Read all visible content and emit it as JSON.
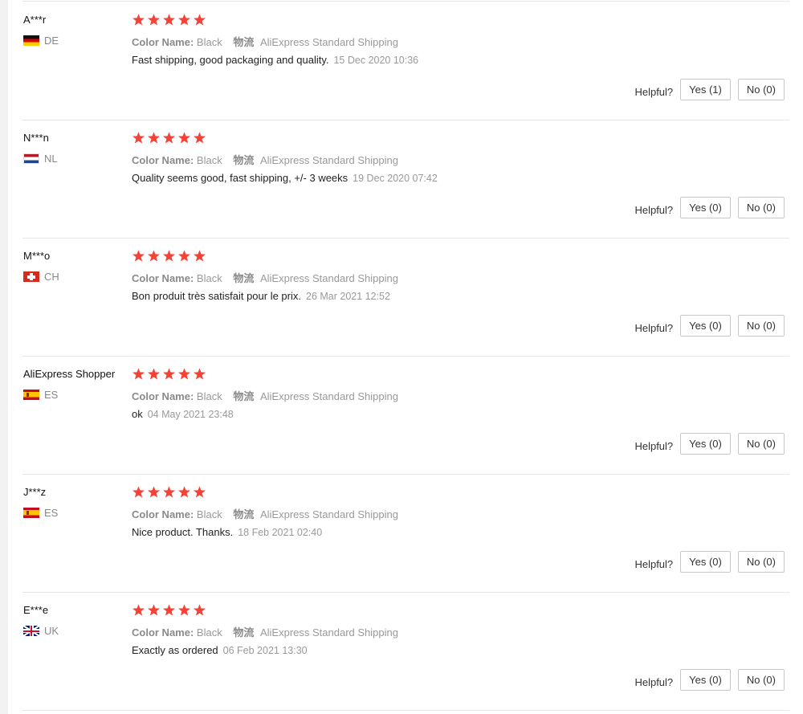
{
  "colors": {
    "star": "#f44336",
    "divider": "#e6e6e6",
    "muted": "#999999"
  },
  "labels": {
    "color_name": "Color Name:",
    "logistics": "物流",
    "helpful": "Helpful?"
  },
  "reviews": [
    {
      "user": "A***r",
      "country": "DE",
      "flag_icon": "flag-de-icon",
      "rating": 5,
      "color": "Black",
      "shipping": "AliExpress Standard Shipping",
      "text": "Fast shipping, good packaging and quality.",
      "date": "15 Dec 2020 10:36",
      "yes": "Yes (1)",
      "no": "No (0)"
    },
    {
      "user": "N***n",
      "country": "NL",
      "flag_icon": "flag-nl-icon",
      "rating": 5,
      "color": "Black",
      "shipping": "AliExpress Standard Shipping",
      "text": "Quality seems good, fast shipping, +/- 3 weeks",
      "date": "19 Dec 2020 07:42",
      "yes": "Yes (0)",
      "no": "No (0)"
    },
    {
      "user": "M***o",
      "country": "CH",
      "flag_icon": "flag-ch-icon",
      "rating": 5,
      "color": "Black",
      "shipping": "AliExpress Standard Shipping",
      "text": "Bon produit très satisfait pour le prix.",
      "date": "26 Mar 2021 12:52",
      "yes": "Yes (0)",
      "no": "No (0)"
    },
    {
      "user": "AliExpress Shopper",
      "country": "ES",
      "flag_icon": "flag-es-icon",
      "rating": 5,
      "color": "Black",
      "shipping": "AliExpress Standard Shipping",
      "text": "ok",
      "date": "04 May 2021 23:48",
      "yes": "Yes (0)",
      "no": "No (0)"
    },
    {
      "user": "J***z",
      "country": "ES",
      "flag_icon": "flag-es-icon",
      "rating": 5,
      "color": "Black",
      "shipping": "AliExpress Standard Shipping",
      "text": "Nice product. Thanks.",
      "date": "18 Feb 2021 02:40",
      "yes": "Yes (0)",
      "no": "No (0)"
    },
    {
      "user": "E***e",
      "country": "UK",
      "flag_icon": "flag-uk-icon",
      "rating": 5,
      "color": "Black",
      "shipping": "AliExpress Standard Shipping",
      "text": "Exactly as ordered",
      "date": "06 Feb 2021 13:30",
      "yes": "Yes (0)",
      "no": "No (0)"
    }
  ]
}
